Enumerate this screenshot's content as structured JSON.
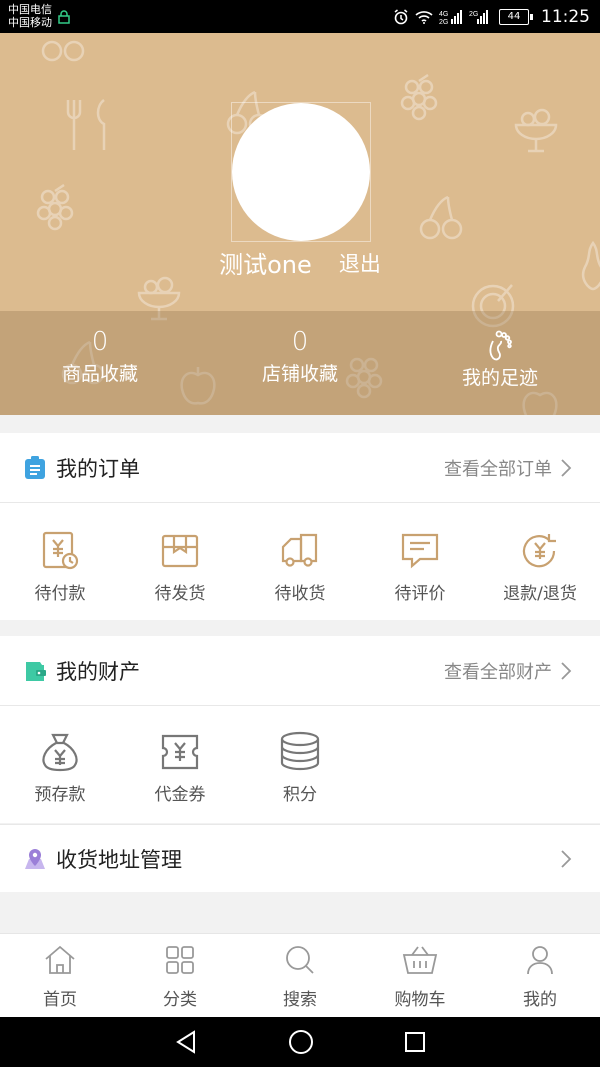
{
  "status_bar": {
    "carrier_1": "中国电信",
    "carrier_2": "中国移动",
    "battery": "44",
    "time": "11:25"
  },
  "profile": {
    "username": "测试one",
    "logout_label": "退出",
    "stats": [
      {
        "value": "0",
        "label": "商品收藏"
      },
      {
        "value": "0",
        "label": "店铺收藏"
      },
      {
        "label": "我的足迹",
        "icon": "footprint-icon"
      }
    ]
  },
  "orders": {
    "title": "我的订单",
    "view_all": "查看全部订单",
    "icon": "clipboard-icon",
    "icon_color": "#3fa3e0",
    "items": [
      {
        "label": "待付款",
        "icon": "payment-pending-icon"
      },
      {
        "label": "待发货",
        "icon": "package-icon"
      },
      {
        "label": "待收货",
        "icon": "truck-icon"
      },
      {
        "label": "待评价",
        "icon": "review-icon"
      },
      {
        "label": "退款/退货",
        "icon": "refund-icon"
      }
    ]
  },
  "assets": {
    "title": "我的财产",
    "view_all": "查看全部财产",
    "icon": "wallet-icon",
    "icon_color": "#3ec9a4",
    "items": [
      {
        "label": "预存款",
        "icon": "money-bag-icon"
      },
      {
        "label": "代金券",
        "icon": "voucher-icon"
      },
      {
        "label": "积分",
        "icon": "coins-icon"
      }
    ]
  },
  "address": {
    "label": "收货地址管理",
    "icon": "map-pin-icon",
    "icon_color": "#9b7fd8"
  },
  "tabbar": {
    "items": [
      {
        "label": "首页",
        "icon": "home-icon"
      },
      {
        "label": "分类",
        "icon": "category-icon"
      },
      {
        "label": "搜索",
        "icon": "search-icon"
      },
      {
        "label": "购物车",
        "icon": "cart-icon"
      },
      {
        "label": "我的",
        "icon": "user-icon"
      }
    ]
  },
  "colors": {
    "header_bg": "#dcbb8f",
    "accent_icon": "#c8a170"
  }
}
